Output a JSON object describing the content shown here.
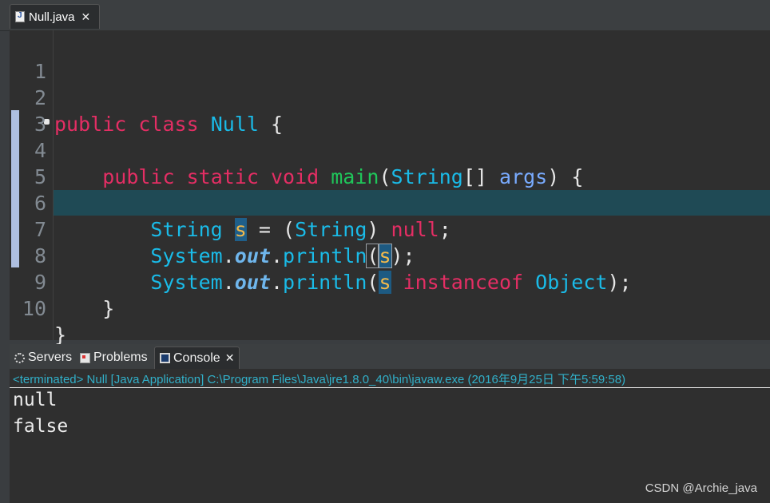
{
  "editor_tab": {
    "label": "Null.java",
    "close": "✕"
  },
  "code_lines": [
    {
      "num": "1"
    },
    {
      "num": "2"
    },
    {
      "num": "3"
    },
    {
      "num": "4"
    },
    {
      "num": "5"
    },
    {
      "num": "6"
    },
    {
      "num": "7"
    },
    {
      "num": "8"
    },
    {
      "num": "9"
    },
    {
      "num": "10"
    }
  ],
  "tokens": {
    "public": "public",
    "class": "class",
    "class_name": "Null",
    "brace_open": "{",
    "static": "static",
    "void": "void",
    "main": "main",
    "lparen": "(",
    "string_arr": "String",
    "brackets": "[]",
    "args": "args",
    "rparen_brace": ") {",
    "String": "String",
    "s": "s",
    "assign": " = (",
    "cast": "String",
    "rparen": ")",
    "null": "null",
    "semi": ";",
    "System": "System",
    "dot": ".",
    "out": "out",
    "println": "println",
    "close_semi": ");",
    "instanceof": "instanceof",
    "Object": "Object",
    "brace_close": "}"
  },
  "console_tabs": [
    {
      "label": "Servers",
      "icon": "servers-icon"
    },
    {
      "label": "Problems",
      "icon": "problems-icon"
    },
    {
      "label": "Console",
      "icon": "console-icon",
      "close": "✕"
    }
  ],
  "console": {
    "header": "<terminated> Null [Java Application] C:\\Program Files\\Java\\jre1.8.0_40\\bin\\javaw.exe (2016年9月25日 下午5:59:58)",
    "output": [
      "null",
      "false"
    ]
  },
  "watermark": "CSDN @Archie_java",
  "colors": {
    "keyword": "#e42e64",
    "type": "#1abbe8",
    "method": "#1fc65a",
    "console_header": "#31b0c9",
    "current_line": "#1f4a55"
  }
}
